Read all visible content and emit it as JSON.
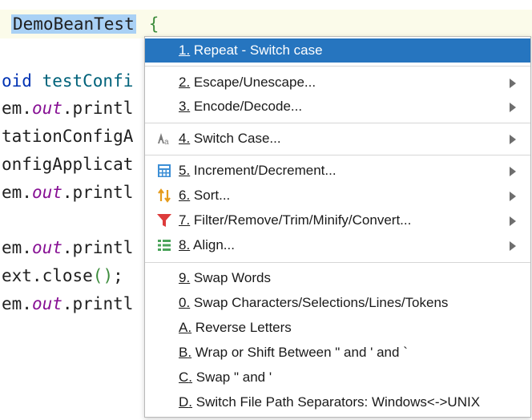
{
  "code": {
    "class_name": "DemoBeanTest",
    "class_brace": "{",
    "lines": [
      {
        "a": "oid ",
        "b": "testConfi"
      },
      {
        "a": "em.",
        "b": "out",
        "c": ".printl"
      },
      {
        "a": "tationConfigA"
      },
      {
        "a": "onfigApplicat"
      },
      {
        "a": "em.",
        "b": "out",
        "c": ".printl"
      },
      {
        "a": "em.",
        "b": "out",
        "c": ".printl"
      },
      {
        "a": "ext.close",
        "b": "()",
        "c": ";"
      },
      {
        "a": "em.",
        "b": "out",
        "c": ".printl"
      }
    ]
  },
  "menu": {
    "items": [
      {
        "num": "1",
        "label": " Repeat - Switch case",
        "icon": "",
        "submenu": false
      },
      {
        "num": "2",
        "label": " Escape/Unescape...",
        "icon": "",
        "submenu": true
      },
      {
        "num": "3",
        "label": " Encode/Decode...",
        "icon": "",
        "submenu": true
      },
      {
        "num": "4",
        "label": " Switch Case...",
        "icon": "switch-case-icon",
        "submenu": true
      },
      {
        "num": "5",
        "label": " Increment/Decrement...",
        "icon": "calculator-icon",
        "submenu": true
      },
      {
        "num": "6",
        "label": " Sort...",
        "icon": "sort-icon",
        "submenu": true
      },
      {
        "num": "7",
        "label": " Filter/Remove/Trim/Minify/Convert...",
        "icon": "filter-icon",
        "submenu": true
      },
      {
        "num": "8",
        "label": " Align...",
        "icon": "align-icon",
        "submenu": true
      },
      {
        "num": "9",
        "label": " Swap Words",
        "icon": "",
        "submenu": false
      },
      {
        "num": "0",
        "label": " Swap Characters/Selections/Lines/Tokens",
        "icon": "",
        "submenu": false
      },
      {
        "num": "A",
        "label": " Reverse Letters",
        "icon": "",
        "submenu": false
      },
      {
        "num": "B",
        "label": " Wrap or Shift Between \" and ' and `",
        "icon": "",
        "submenu": false
      },
      {
        "num": "C",
        "label": " Swap \" and '",
        "icon": "",
        "submenu": false
      },
      {
        "num": "D",
        "label": " Switch File Path Separators: Windows<->UNIX",
        "icon": "",
        "submenu": false
      }
    ],
    "num_suffix": "."
  },
  "colors": {
    "highlight": "#2675bf",
    "selection": "#a9d1f5",
    "icon_blue": "#3d8fd6",
    "icon_orange": "#e59b1b",
    "icon_red": "#dd3b3b",
    "icon_green": "#4aa35a"
  }
}
